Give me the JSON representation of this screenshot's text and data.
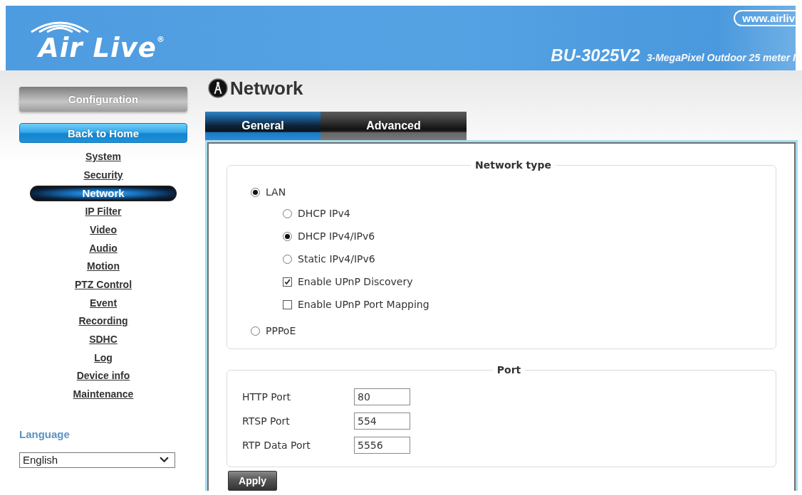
{
  "header": {
    "logo": "Air Live$^{®}$",
    "website": "www.airliv",
    "model": "BU-3025V2",
    "description": "3-MegaPixel Outdoor 25 meter I"
  },
  "sidebar": {
    "title_button": "Configuration",
    "home_button": "Back to Home",
    "items": [
      {
        "label": "System",
        "selected": false
      },
      {
        "label": "Security",
        "selected": false
      },
      {
        "label": "Network",
        "selected": true
      },
      {
        "label": "IP Filter",
        "selected": false
      },
      {
        "label": "Video",
        "selected": false
      },
      {
        "label": "Audio",
        "selected": false
      },
      {
        "label": "Motion",
        "selected": false
      },
      {
        "label": "PTZ Control",
        "selected": false
      },
      {
        "label": "Event",
        "selected": false
      },
      {
        "label": "Recording",
        "selected": false
      },
      {
        "label": "SDHC",
        "selected": false
      },
      {
        "label": "Log",
        "selected": false
      },
      {
        "label": "Device info",
        "selected": false
      },
      {
        "label": "Maintenance",
        "selected": false
      }
    ],
    "language": {
      "label": "Language",
      "value": "English"
    }
  },
  "page_title": "Network",
  "tabs": [
    {
      "label": "General",
      "selected": true
    },
    {
      "label": "Advanced",
      "selected": false
    }
  ],
  "network_type": {
    "legend": "Network type",
    "items": [
      {
        "kind": "radio",
        "label": "LAN",
        "selected": true,
        "children": [
          {
            "kind": "radio",
            "label": "DHCP IPv4",
            "selected": false
          },
          {
            "kind": "radio",
            "label": "DHCP IPv4/IPv6",
            "selected": true
          },
          {
            "kind": "radio",
            "label": "Static IPv4/IPv6",
            "selected": false
          },
          {
            "kind": "checkbox",
            "label": "Enable UPnP Discovery",
            "checked": true
          },
          {
            "kind": "checkbox",
            "label": "Enable UPnP Port Mapping",
            "checked": false
          }
        ]
      },
      {
        "kind": "radio",
        "label": "PPPoE",
        "selected": false
      }
    ]
  },
  "port": {
    "legend": "Port",
    "fields": [
      {
        "label": "HTTP Port",
        "value": "80"
      },
      {
        "label": "RTSP Port",
        "value": "554"
      },
      {
        "label": "RTP Data Port",
        "value": "5556"
      }
    ]
  },
  "apply_button": "Apply"
}
